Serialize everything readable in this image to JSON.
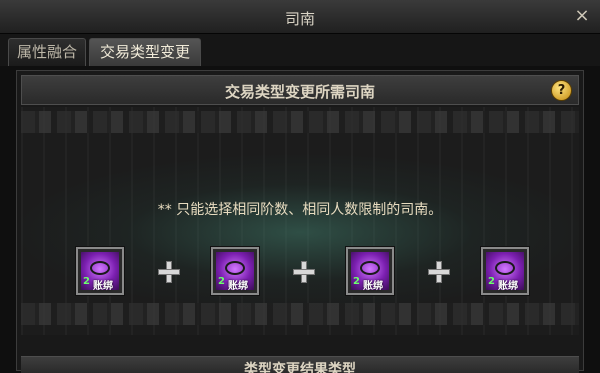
{
  "window": {
    "title": "司南",
    "close_glyph": "×"
  },
  "tabs": [
    {
      "label": "属性融合",
      "active": false
    },
    {
      "label": "交易类型变更",
      "active": true
    }
  ],
  "panel": {
    "title": "交易类型变更所需司南",
    "help_glyph": "?",
    "notice": "** 只能选择相同阶数、相同人数限制的司南。",
    "slots": [
      {
        "count": "2",
        "label": "账绑",
        "icon": "compass-icon",
        "rarity_color": "#a040e0"
      },
      {
        "count": "2",
        "label": "账绑",
        "icon": "compass-icon",
        "rarity_color": "#a040e0"
      },
      {
        "count": "2",
        "label": "账绑",
        "icon": "compass-icon",
        "rarity_color": "#a040e0"
      },
      {
        "count": "2",
        "label": "账绑",
        "icon": "compass-icon",
        "rarity_color": "#a040e0"
      }
    ],
    "bottom_title": "类型变更结果类型"
  }
}
